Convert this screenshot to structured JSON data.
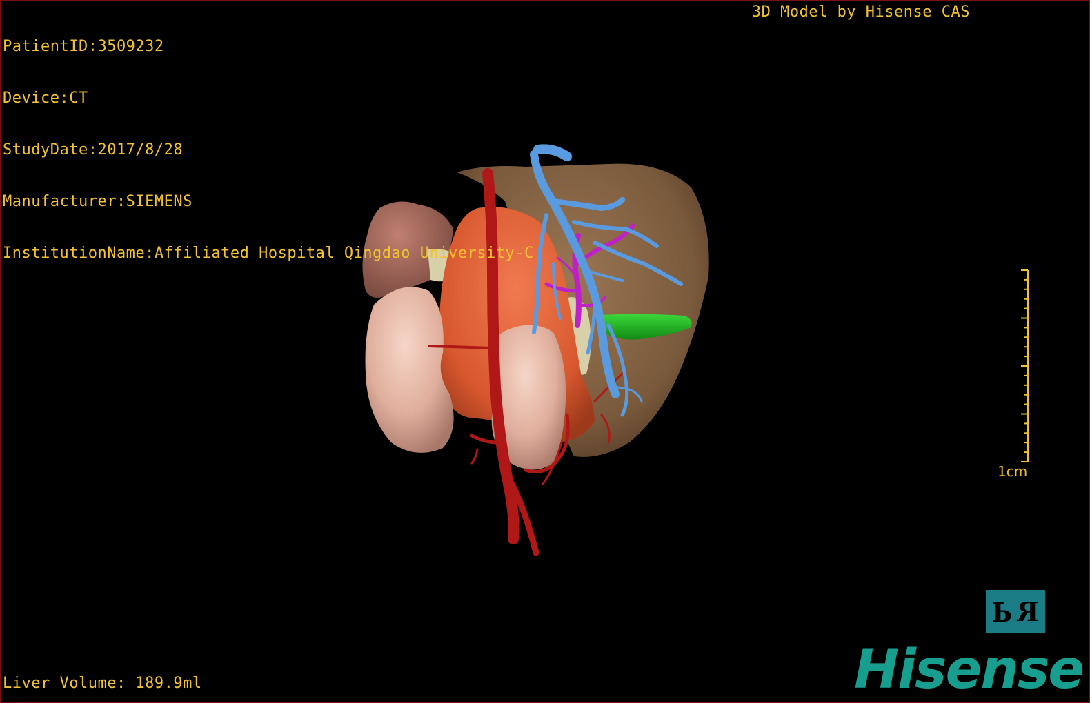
{
  "dicom_info": {
    "patient_id": "PatientID:3509232",
    "device": "Device:CT",
    "study_date": "StudyDate:2017/8/28",
    "manufacturer": "Manufacturer:SIEMENS",
    "institution": "InstitutionName:Affiliated Hospital Qingdao University-C"
  },
  "brand_label": "3D Model by Hisense CAS",
  "liver_volume": "Liver Volume: 189.9ml",
  "scale": {
    "label": "1cm",
    "value_cm": 1
  },
  "orientation_cube": {
    "left_face": "P",
    "right_face": "R"
  },
  "logo": "Hisense",
  "colors": {
    "overlay_text": "#f2c230",
    "border": "#7a1010",
    "liver": "#7a5a3c",
    "spleen": "#e0643c",
    "kidney": "#e0b0a0",
    "artery": "#b01818",
    "hepatic_vein": "#5a9be0",
    "portal_vein": "#c020c8",
    "gallbladder": "#22b822",
    "bile_duct": "#d8d0a8",
    "logo": "#179e8e",
    "cube": "#1a7c84"
  }
}
